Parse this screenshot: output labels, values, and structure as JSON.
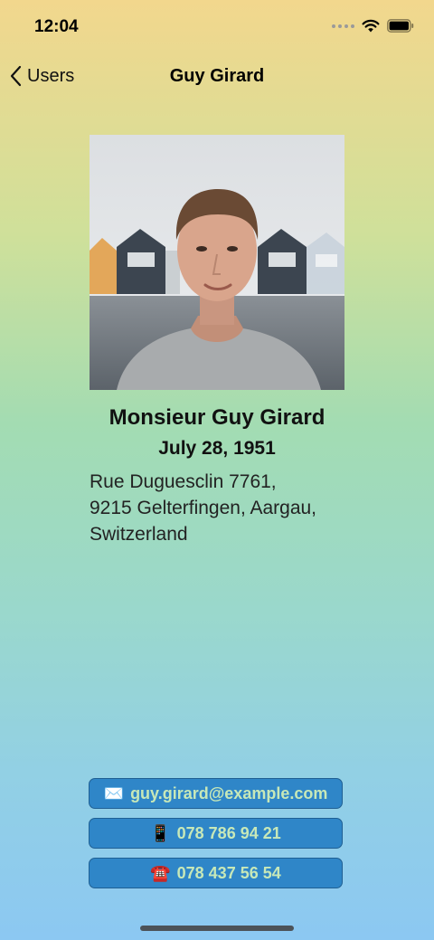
{
  "status_bar": {
    "time": "12:04"
  },
  "nav": {
    "back_label": "Users",
    "title": "Guy Girard"
  },
  "profile": {
    "full_name": "Monsieur Guy Girard",
    "birth_date": "July 28, 1951",
    "address_lines": [
      "Rue Duguesclin 7761,",
      "9215 Gelterfingen, Aargau,",
      "Switzerland"
    ]
  },
  "contacts": {
    "email": {
      "icon": "envelope-icon",
      "glyph": "✉️",
      "label": "guy.girard@example.com"
    },
    "mobile": {
      "icon": "mobile-phone-icon",
      "glyph": "📱",
      "label": "078 786 94 21"
    },
    "phone": {
      "icon": "telephone-icon",
      "glyph": "☎️",
      "label": "078 437 56 54"
    }
  },
  "colors": {
    "button_background": "#2f86c8",
    "button_text": "#c7e8b8",
    "gradient_top": "#f2d78d",
    "gradient_middle": "#a3dcb2",
    "gradient_bottom": "#8cc8f2"
  }
}
